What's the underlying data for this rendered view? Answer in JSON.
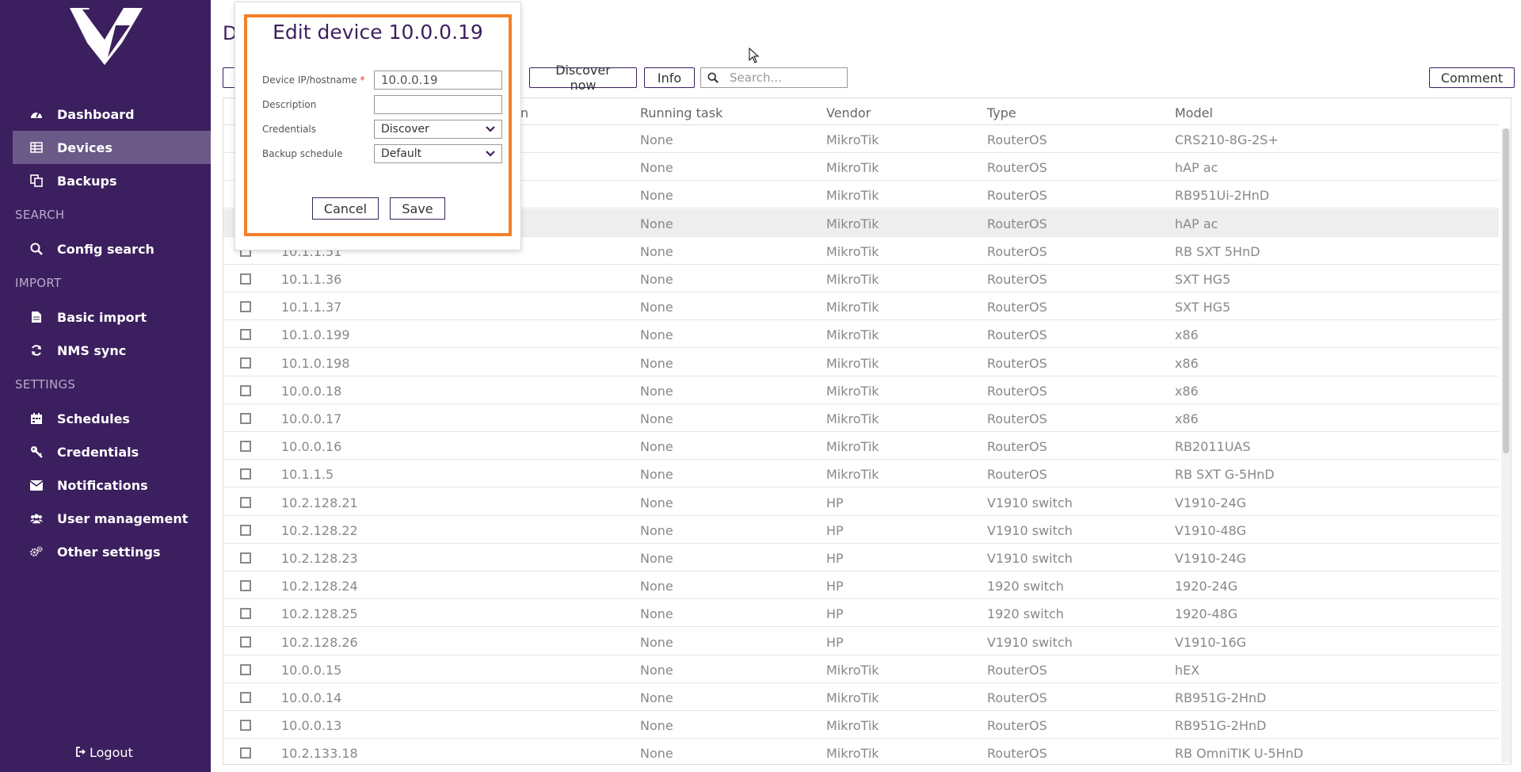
{
  "sidebar": {
    "items": [
      {
        "label": "Dashboard",
        "icon": "dashboard-icon"
      },
      {
        "label": "Devices",
        "icon": "table-icon"
      },
      {
        "label": "Backups",
        "icon": "copy-icon"
      }
    ],
    "section_search": "SEARCH",
    "search_items": [
      {
        "label": "Config search",
        "icon": "search-icon"
      }
    ],
    "section_import": "IMPORT",
    "import_items": [
      {
        "label": "Basic import",
        "icon": "file-icon"
      },
      {
        "label": "NMS sync",
        "icon": "refresh-icon"
      }
    ],
    "section_settings": "SETTINGS",
    "settings_items": [
      {
        "label": "Schedules",
        "icon": "calendar-icon"
      },
      {
        "label": "Credentials",
        "icon": "key-icon"
      },
      {
        "label": "Notifications",
        "icon": "envelope-icon"
      },
      {
        "label": "User management",
        "icon": "users-icon"
      },
      {
        "label": "Other settings",
        "icon": "gears-icon"
      }
    ],
    "logout": "Logout"
  },
  "header": {
    "title": "D"
  },
  "toolbar": {
    "discover_now": "Discover now",
    "info": "Info",
    "search_placeholder": "Search...",
    "comment": "Comment"
  },
  "table": {
    "columns": [
      "n",
      "Running task",
      "Vendor",
      "Type",
      "Model"
    ],
    "rows": [
      {
        "ip": "",
        "task": "None",
        "vendor": "MikroTik",
        "type": "RouterOS",
        "model": "CRS210-8G-2S+"
      },
      {
        "ip": "",
        "task": "None",
        "vendor": "MikroTik",
        "type": "RouterOS",
        "model": "hAP ac"
      },
      {
        "ip": "",
        "task": "None",
        "vendor": "MikroTik",
        "type": "RouterOS",
        "model": "RB951Ui-2HnD"
      },
      {
        "ip": "",
        "task": "None",
        "vendor": "MikroTik",
        "type": "RouterOS",
        "model": "hAP ac"
      },
      {
        "ip": "10.1.1.51",
        "task": "None",
        "vendor": "MikroTik",
        "type": "RouterOS",
        "model": "RB SXT 5HnD"
      },
      {
        "ip": "10.1.1.36",
        "task": "None",
        "vendor": "MikroTik",
        "type": "RouterOS",
        "model": "SXT HG5"
      },
      {
        "ip": "10.1.1.37",
        "task": "None",
        "vendor": "MikroTik",
        "type": "RouterOS",
        "model": "SXT HG5"
      },
      {
        "ip": "10.1.0.199",
        "task": "None",
        "vendor": "MikroTik",
        "type": "RouterOS",
        "model": "x86"
      },
      {
        "ip": "10.1.0.198",
        "task": "None",
        "vendor": "MikroTik",
        "type": "RouterOS",
        "model": "x86"
      },
      {
        "ip": "10.0.0.18",
        "task": "None",
        "vendor": "MikroTik",
        "type": "RouterOS",
        "model": "x86"
      },
      {
        "ip": "10.0.0.17",
        "task": "None",
        "vendor": "MikroTik",
        "type": "RouterOS",
        "model": "x86"
      },
      {
        "ip": "10.0.0.16",
        "task": "None",
        "vendor": "MikroTik",
        "type": "RouterOS",
        "model": "RB2011UAS"
      },
      {
        "ip": "10.1.1.5",
        "task": "None",
        "vendor": "MikroTik",
        "type": "RouterOS",
        "model": "RB SXT G-5HnD"
      },
      {
        "ip": "10.2.128.21",
        "task": "None",
        "vendor": "HP",
        "type": "V1910 switch",
        "model": "V1910-24G"
      },
      {
        "ip": "10.2.128.22",
        "task": "None",
        "vendor": "HP",
        "type": "V1910 switch",
        "model": "V1910-48G"
      },
      {
        "ip": "10.2.128.23",
        "task": "None",
        "vendor": "HP",
        "type": "V1910 switch",
        "model": "V1910-24G"
      },
      {
        "ip": "10.2.128.24",
        "task": "None",
        "vendor": "HP",
        "type": "1920 switch",
        "model": "1920-24G"
      },
      {
        "ip": "10.2.128.25",
        "task": "None",
        "vendor": "HP",
        "type": "1920 switch",
        "model": "1920-48G"
      },
      {
        "ip": "10.2.128.26",
        "task": "None",
        "vendor": "HP",
        "type": "V1910 switch",
        "model": "V1910-16G"
      },
      {
        "ip": "10.0.0.15",
        "task": "None",
        "vendor": "MikroTik",
        "type": "RouterOS",
        "model": "hEX"
      },
      {
        "ip": "10.0.0.14",
        "task": "None",
        "vendor": "MikroTik",
        "type": "RouterOS",
        "model": "RB951G-2HnD"
      },
      {
        "ip": "10.0.0.13",
        "task": "None",
        "vendor": "MikroTik",
        "type": "RouterOS",
        "model": "RB951G-2HnD"
      },
      {
        "ip": "10.2.133.18",
        "task": "None",
        "vendor": "MikroTik",
        "type": "RouterOS",
        "model": "RB OmniTIK U-5HnD"
      }
    ]
  },
  "modal": {
    "title": "Edit device 10.0.0.19",
    "ip_label": "Device IP/hostname",
    "required_mark": "*",
    "ip_value": "10.0.0.19",
    "description_label": "Description",
    "description_value": "",
    "credentials_label": "Credentials",
    "credentials_value": "Discover",
    "schedule_label": "Backup schedule",
    "schedule_value": "Default",
    "cancel": "Cancel",
    "save": "Save"
  },
  "colors": {
    "sidebar_bg": "#3c1f5e",
    "active_item_bg": "#6b5a87",
    "modal_border": "#f47f28",
    "required": "#d9362b"
  }
}
